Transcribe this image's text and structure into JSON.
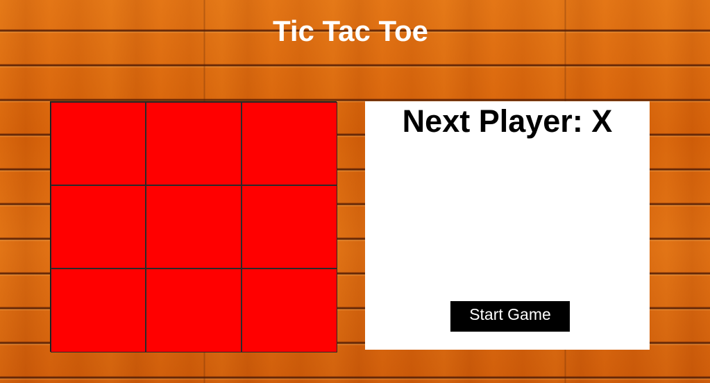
{
  "title": "Tic Tac Toe",
  "board": {
    "cell_color": "#ff0000",
    "cells": [
      "",
      "",
      "",
      "",
      "",
      "",
      "",
      "",
      ""
    ]
  },
  "status": {
    "text": "Next Player: X"
  },
  "controls": {
    "start_label": "Start Game"
  }
}
